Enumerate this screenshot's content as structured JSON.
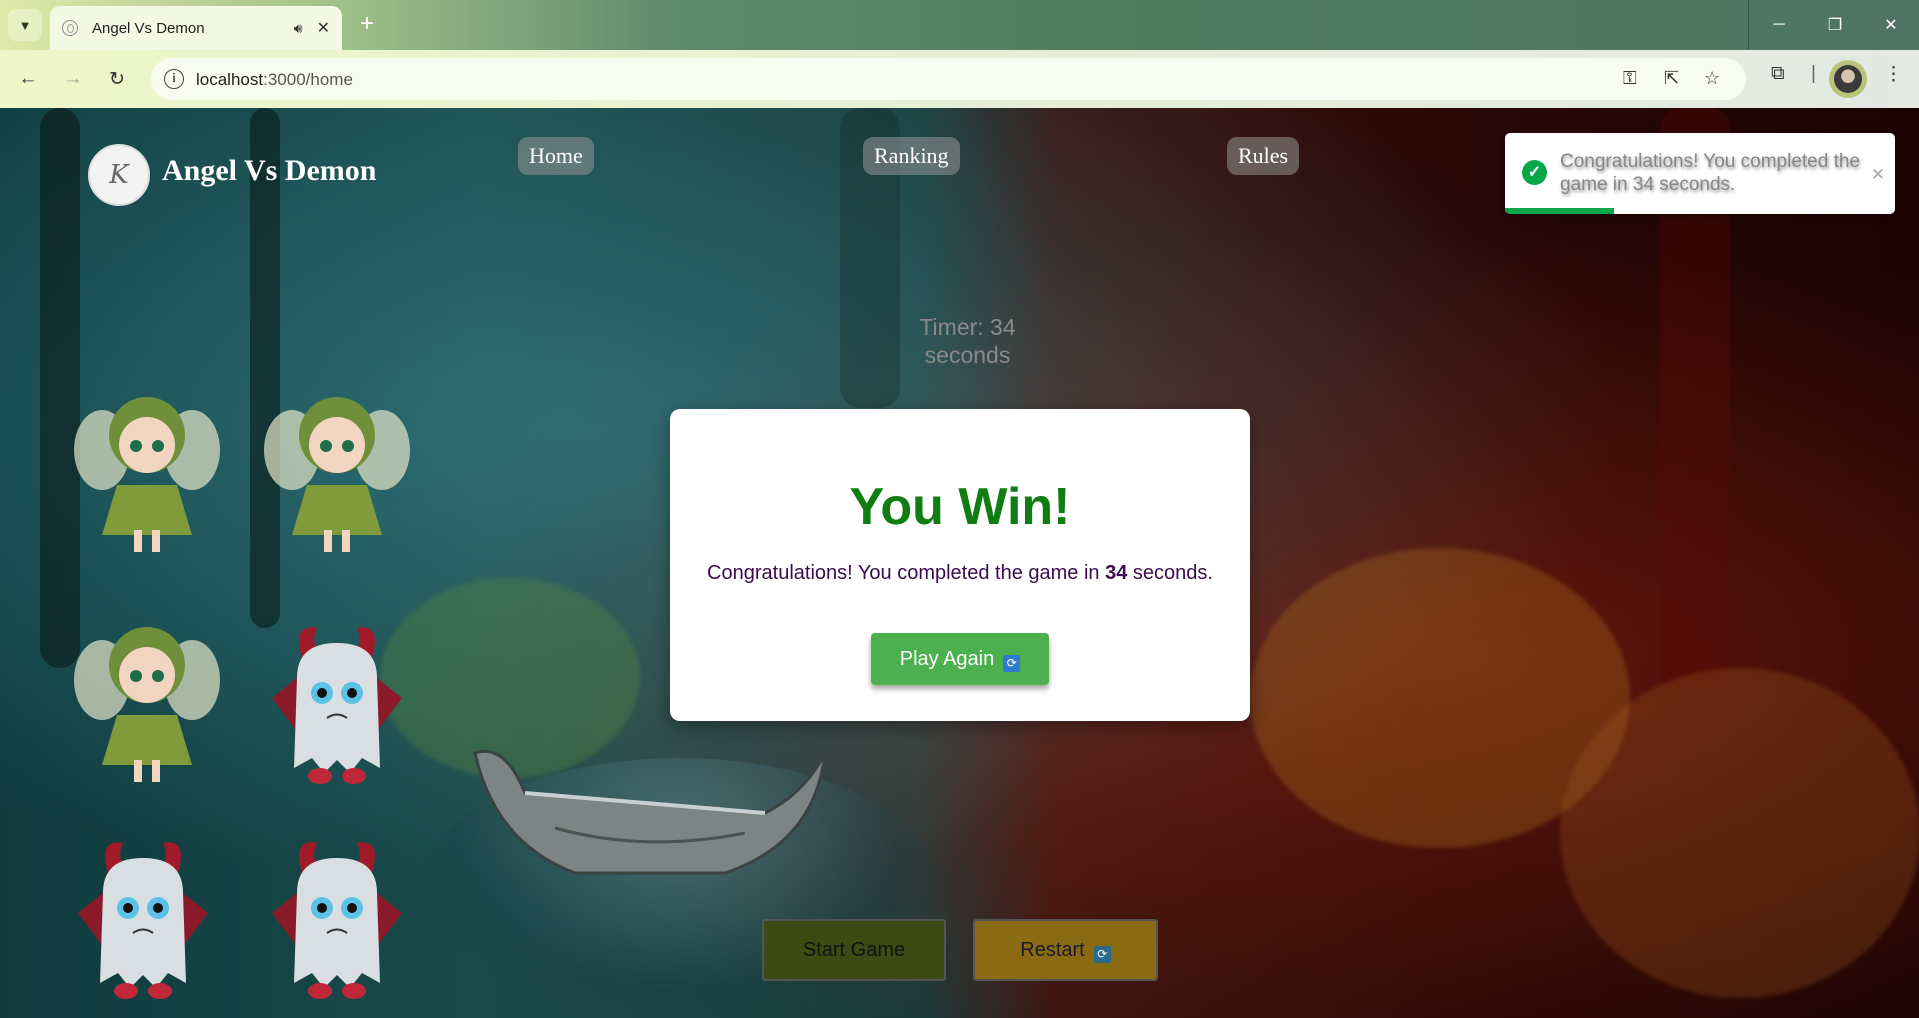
{
  "browser": {
    "tab_title": "Angel Vs Demon",
    "url_host": "localhost",
    "url_path": ":3000/home",
    "new_tab_label": "+"
  },
  "site": {
    "title": "Angel Vs Demon",
    "logo_mark": "K",
    "nav": {
      "home": "Home",
      "ranking": "Ranking",
      "rules": "Rules"
    }
  },
  "game": {
    "timer_line1": "Timer: 34",
    "timer_line2": "seconds",
    "start_button": "Start Game",
    "restart_button": "Restart",
    "angels_remaining": 3,
    "demons_remaining": 3
  },
  "modal": {
    "heading": "You Win!",
    "msg_prefix": "Congratulations! You completed the game in ",
    "msg_seconds": "34",
    "msg_suffix": " seconds.",
    "play_again": "Play Again"
  },
  "toast": {
    "message": "Congratulations! You completed the game in 34 seconds.",
    "progress_fraction": 0.28
  },
  "colors": {
    "win_green": "#0f7d12",
    "button_green": "#4caf50",
    "toast_green": "#08a84a",
    "msg_text": "#3b0b50"
  }
}
